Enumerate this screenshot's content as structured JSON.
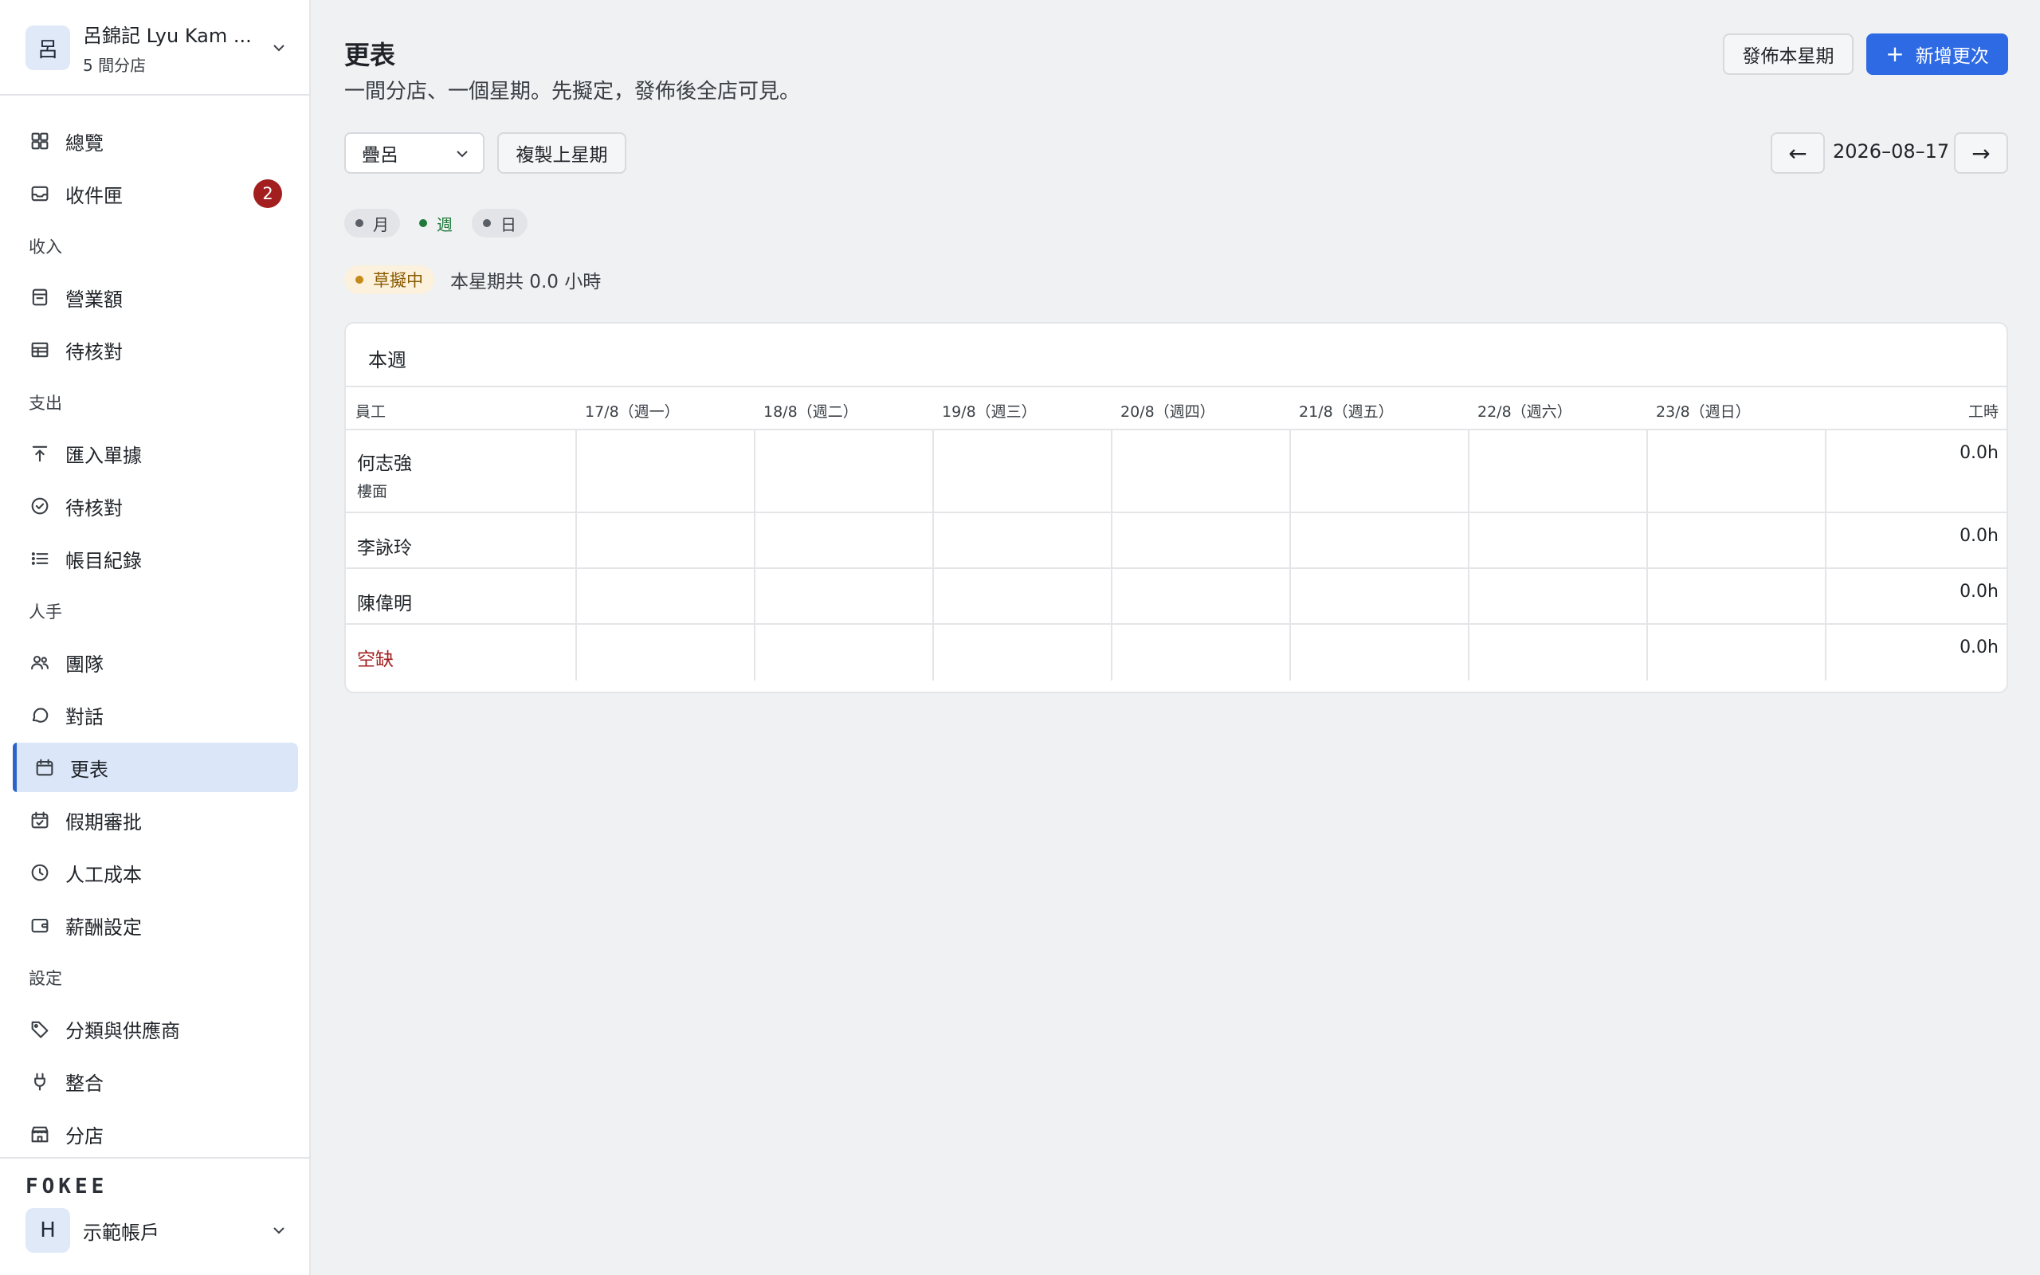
{
  "sidebar": {
    "org": {
      "avatar_letter": "呂",
      "name": "呂錦記 Lyu Kam ...",
      "subtitle": "5 間分店"
    },
    "items": [
      {
        "label": "總覽",
        "icon": "dashboard-icon"
      },
      {
        "label": "收件匣",
        "icon": "inbox-icon",
        "badge": "2"
      }
    ],
    "sections": [
      {
        "title": "收入",
        "items": [
          {
            "label": "營業額",
            "icon": "receipt-icon"
          },
          {
            "label": "待核對",
            "icon": "table-icon"
          }
        ]
      },
      {
        "title": "支出",
        "items": [
          {
            "label": "匯入單據",
            "icon": "upload-icon"
          },
          {
            "label": "待核對",
            "icon": "check-circle-icon"
          },
          {
            "label": "帳目紀錄",
            "icon": "list-icon"
          }
        ]
      },
      {
        "title": "人手",
        "items": [
          {
            "label": "團隊",
            "icon": "users-icon"
          },
          {
            "label": "對話",
            "icon": "chat-icon"
          },
          {
            "label": "更表",
            "icon": "calendar-icon",
            "active": true
          },
          {
            "label": "假期審批",
            "icon": "calendar-check-icon"
          },
          {
            "label": "人工成本",
            "icon": "clock-icon"
          },
          {
            "label": "薪酬設定",
            "icon": "wallet-icon"
          }
        ]
      },
      {
        "title": "設定",
        "items": [
          {
            "label": "分類與供應商",
            "icon": "tag-icon"
          },
          {
            "label": "整合",
            "icon": "plug-icon"
          },
          {
            "label": "分店",
            "icon": "store-icon"
          }
        ]
      }
    ],
    "brand": "FOKEE",
    "account": {
      "avatar_letter": "H",
      "name": "示範帳戶"
    }
  },
  "header": {
    "title": "更表",
    "subtitle": "一間分店、一個星期。先擬定，發佈後全店可見。",
    "publish_label": "發佈本星期",
    "new_shift_label": "新增更次",
    "accent": "#2d6ae3"
  },
  "toolbar": {
    "branch": "疊呂",
    "copy_label": "複製上星期",
    "prev_label": "←",
    "date": "2026–08–17",
    "next_label": "→"
  },
  "views": [
    {
      "label": "月",
      "active": false
    },
    {
      "label": "週",
      "active": true
    },
    {
      "label": "日",
      "active": false
    }
  ],
  "status": {
    "badge": "草擬中",
    "summary": "本星期共 0.0 小時"
  },
  "schedule": {
    "title": "本週",
    "columns": [
      "員工",
      "17/8（週一）",
      "18/8（週二）",
      "19/8（週三）",
      "20/8（週四）",
      "21/8（週五）",
      "22/8（週六）",
      "23/8（週日）",
      "工時"
    ],
    "rows": [
      {
        "name": "何志強",
        "role": "樓面",
        "hours": "0.0h",
        "vacant": false
      },
      {
        "name": "李詠玲",
        "role": "",
        "hours": "0.0h",
        "vacant": false
      },
      {
        "name": "陳偉明",
        "role": "",
        "hours": "0.0h",
        "vacant": false
      },
      {
        "name": "空缺",
        "role": "",
        "hours": "0.0h",
        "vacant": true
      }
    ]
  }
}
